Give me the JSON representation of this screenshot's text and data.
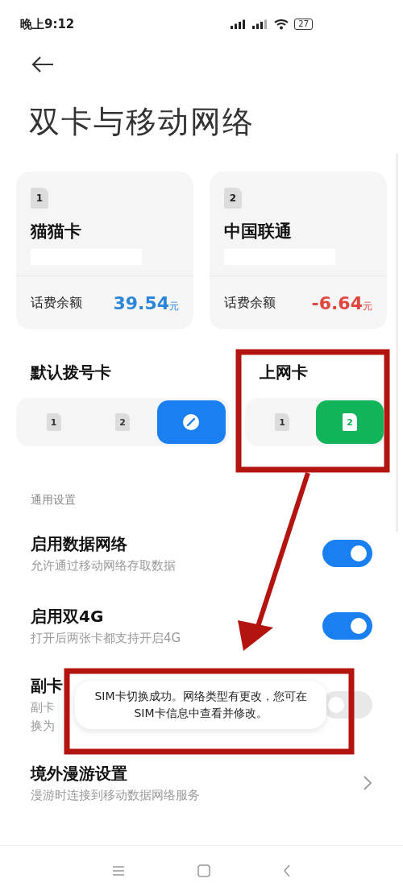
{
  "status_bar": {
    "time": "晚上9:12",
    "battery": "27"
  },
  "page": {
    "title": "双卡与移动网络"
  },
  "sim_cards": [
    {
      "slot": "1",
      "name": "猫猫卡",
      "balance_label": "话费余额",
      "amount": "39.54",
      "unit": "元",
      "color": "#2b86d9"
    },
    {
      "slot": "2",
      "name": "中国联通",
      "balance_label": "话费余额",
      "amount": "-6.64",
      "unit": "元",
      "color": "#e0473f"
    }
  ],
  "selectors": [
    {
      "title": "默认拨号卡",
      "color": "#1a7ff0",
      "options": [
        {
          "kind": "sim",
          "label": "1",
          "selected": false
        },
        {
          "kind": "sim",
          "label": "2",
          "selected": false
        },
        {
          "kind": "smart",
          "selected": true
        }
      ]
    },
    {
      "title": "上网卡",
      "color": "#12b45a",
      "options": [
        {
          "kind": "sim",
          "label": "1",
          "selected": false
        },
        {
          "kind": "sim",
          "label": "2",
          "selected": true
        }
      ]
    }
  ],
  "section_label": "通用设置",
  "settings": [
    {
      "kind": "toggle",
      "title": "启用数据网络",
      "description_lines": [
        "允许通过移动网络存取数据"
      ],
      "on": true
    },
    {
      "kind": "toggle",
      "title": "启用双4G",
      "description_lines": [
        "打开后两张卡都支持开启4G"
      ],
      "on": true
    },
    {
      "kind": "toggle",
      "title": "副卡",
      "description_lines": [
        "副卡",
        "换为"
      ],
      "on": false
    },
    {
      "kind": "link",
      "title": "境外漫游设置",
      "description_lines": [
        "漫游时连接到移动数据网络服务"
      ]
    }
  ],
  "toast": {
    "text": "SIM卡切换成功。网络类型有更改，您可在\nSIM卡信息中查看并修改。"
  }
}
